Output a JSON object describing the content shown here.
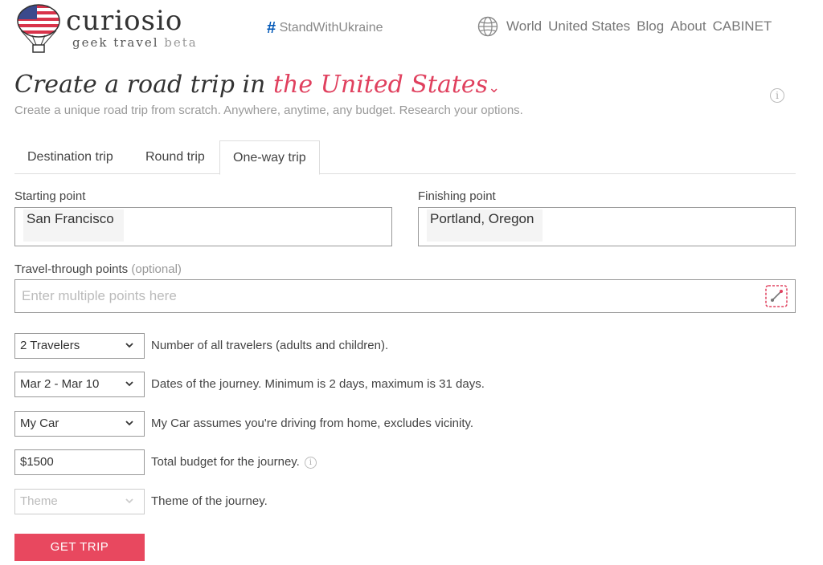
{
  "header": {
    "logo_name": "curiosio",
    "logo_tagline": "geek travel",
    "logo_beta": "beta",
    "ukraine_hash": "#",
    "ukraine_text": "StandWithUkraine",
    "nav": [
      "World",
      "United States",
      "Blog",
      "About",
      "CABINET"
    ]
  },
  "title": {
    "prefix": "Create a road trip in",
    "place": "the United States",
    "caret": "⌄",
    "subtitle": "Create a unique road trip from scratch. Anywhere, anytime, any budget. Research your options.",
    "info": "i"
  },
  "tabs": [
    {
      "label": "Destination trip",
      "active": false
    },
    {
      "label": "Round trip",
      "active": false
    },
    {
      "label": "One-way trip",
      "active": true
    }
  ],
  "form": {
    "start_label": "Starting point",
    "start_value": "San Francisco",
    "finish_label": "Finishing point",
    "finish_value": "Portland, Oregon",
    "through_label": "Travel-through points",
    "through_optional": "(optional)",
    "through_placeholder": "Enter multiple points here",
    "travelers_value": "2 Travelers",
    "travelers_desc": "Number of all travelers (adults and children).",
    "dates_value": "Mar 2 - Mar 10",
    "dates_desc": "Dates of the journey. Minimum is 2 days, maximum is 31 days.",
    "vehicle_value": "My Car",
    "vehicle_desc": "My Car assumes you're driving from home, excludes vicinity.",
    "budget_value": "$1500",
    "budget_desc": "Total budget for the journey.",
    "budget_info": "i",
    "theme_placeholder": "Theme",
    "theme_desc": "Theme of the journey.",
    "submit_label": "GET TRIP"
  },
  "colors": {
    "accent": "#e0405e",
    "button": "#e8485f"
  }
}
